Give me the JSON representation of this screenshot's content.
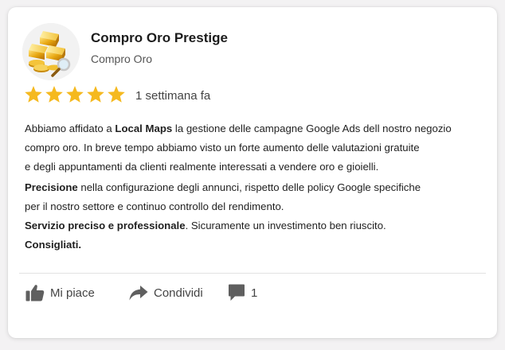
{
  "business": {
    "name": "Compro Oro Prestige",
    "category": "Compro Oro",
    "avatar_icon": "gold-bars-icon"
  },
  "review": {
    "rating": 5,
    "rating_max": 5,
    "star_color": "#f5b91f",
    "time": "1 settimana fa",
    "p1_pre": "Abbiamo affidato a ",
    "p1_bold": "Local Maps",
    "p1_line1_post": " la gestione delle campagne Google Ads dell nostro negozio",
    "p1_line2": "compro oro. In breve tempo abbiamo visto un forte aumento delle valutazioni gratuite",
    "p1_line3": "e degli appuntamenti da clienti realmente interessati a vendere oro e gioielli.",
    "p2_bold": "Precisione",
    "p2_line1_post": " nella configurazione degli annunci, rispetto delle policy Google specifiche",
    "p2_line2": "per il nostro settore e continuo controllo del rendimento.",
    "p3_bold": "Servizio preciso e professionale",
    "p3_post": ". Sicuramente un investimento ben riuscito.",
    "p4_bold": "Consigliati."
  },
  "actions": {
    "like": {
      "label": "Mi piace",
      "icon": "thumbs-up-icon"
    },
    "share": {
      "label": "Condividi",
      "icon": "share-arrow-icon"
    },
    "comment": {
      "count": "1",
      "icon": "comment-icon"
    }
  }
}
